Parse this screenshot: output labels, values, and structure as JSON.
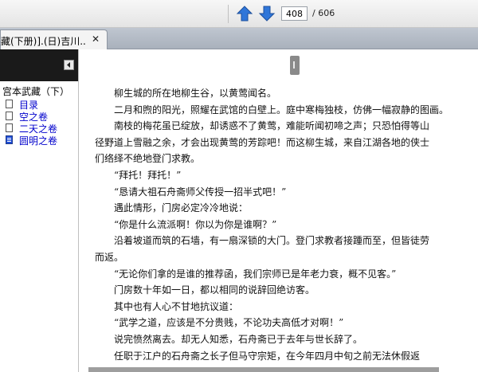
{
  "toolbar": {
    "up_icon": "up-arrow-icon",
    "down_icon": "down-arrow-icon",
    "current_page": "408",
    "total_pages": "/ 606",
    "accent": "#2f76d9"
  },
  "tab": {
    "title": "藏(下册)].(日)吉川...",
    "close": "✕"
  },
  "sidebar": {
    "root": "宫本武藏（下）",
    "items": [
      {
        "label": "目录",
        "active": false
      },
      {
        "label": "空之卷",
        "active": false
      },
      {
        "label": "二天之卷",
        "active": false
      },
      {
        "label": "圆明之卷",
        "active": true
      }
    ]
  },
  "content": {
    "lines": [
      {
        "text": "柳生城的所在地柳生谷，以黄莺闻名。",
        "indent": true
      },
      {
        "text": "二月和煦的阳光，照耀在武馆的白壁上。庭中寒梅独枝，仿佛一幅寂静的图画。",
        "indent": true
      },
      {
        "text": "南枝的梅花虽已绽放，却诱惑不了黄莺，难能听闻初啼之声；只恐怕得等山",
        "indent": true
      },
      {
        "text": "径野道上雪融之余，才会出现黄莺的芳踪吧！而这柳生城，来自江湖各地的侠士",
        "indent": false
      },
      {
        "text": "们络绎不绝地登门求教。",
        "indent": false
      },
      {
        "text": "“拜托！拜托！”",
        "indent": true
      },
      {
        "text": "“恳请大祖石舟斋师父传授一招半式吧！”",
        "indent": true
      },
      {
        "text": "遇此情形，门房必定冷冷地说：",
        "indent": true
      },
      {
        "text": "“你是什么流派啊！你以为你是谁啊？”",
        "indent": true
      },
      {
        "text": "沿着坡道而筑的石墙，有一扇深锁的大门。登门求教者接踵而至，但皆徒劳",
        "indent": true
      },
      {
        "text": "而返。",
        "indent": false
      },
      {
        "text": "“无论你们拿的是谁的推荐函，我们宗师已是年老力衰，概不见客。”",
        "indent": true
      },
      {
        "text": "门房数十年如一日，都以相同的说辞回绝访客。",
        "indent": true
      },
      {
        "text": "其中也有人心不甘地抗议道：",
        "indent": true
      },
      {
        "text": "“武学之道，应该是不分贵贱，不论功夫高低才对啊！”",
        "indent": true
      },
      {
        "text": "说完愤然离去。却无人知悉，石舟斋已于去年与世长辞了。",
        "indent": true
      },
      {
        "text": "任职于江户的石舟斋之长子但马守宗矩，在今年四月中旬之前无法休假返",
        "indent": true
      }
    ]
  }
}
